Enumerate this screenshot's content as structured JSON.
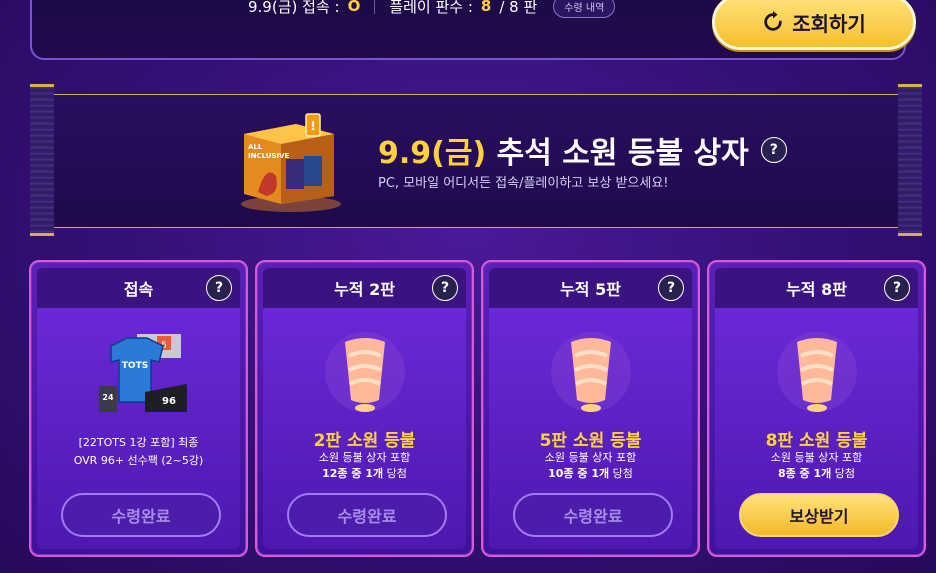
{
  "topbar": {
    "date_label": "9.9(금) 접속 :",
    "access_value": "O",
    "plays_label": "플레이 판수 :",
    "plays_current": "8",
    "plays_total": "/ 8 판",
    "history_label": "수령 내역",
    "refresh_label": "조회하기"
  },
  "banner": {
    "title_highlight": "9.9(금)",
    "title_rest": "추석 소원 등불 상자",
    "help_label": "?",
    "subtitle": "PC, 모바일 어디서든 접속/플레이하고 보상 받으세요!",
    "chest_text": "ALL INCLUSIVE"
  },
  "cards": [
    {
      "header": "접속",
      "help": "?",
      "desc_line1": "[22TOTS 1강 포함] 최종",
      "desc_line2": "OVR 96+ 선수팩 (2~5강)",
      "pack_label": "TOTS",
      "pack_num": "24",
      "pack_ovr": "96",
      "pack_badge": "5",
      "button": "수령완료",
      "state": "done"
    },
    {
      "header": "누적 2판",
      "help": "?",
      "name": "2판 소원 등불",
      "line1": "소원 등불 상자 포함",
      "line2a": "12종 중 1개",
      "line2b": " 당첨",
      "button": "수령완료",
      "state": "done"
    },
    {
      "header": "누적 5판",
      "help": "?",
      "name": "5판 소원 등불",
      "line1": "소원 등불 상자 포함",
      "line2a": "10종 중 1개",
      "line2b": " 당첨",
      "button": "수령완료",
      "state": "done"
    },
    {
      "header": "누적 8판",
      "help": "?",
      "name": "8판 소원 등불",
      "line1": "소원 등불 상자 포함",
      "line2a": "8종 중 1개",
      "line2b": " 당첨",
      "button": "보상받기",
      "state": "claimable"
    }
  ],
  "colors": {
    "accent_gold": "#ffd23c",
    "card_border": "#d85ad8",
    "background": "#36127a"
  }
}
